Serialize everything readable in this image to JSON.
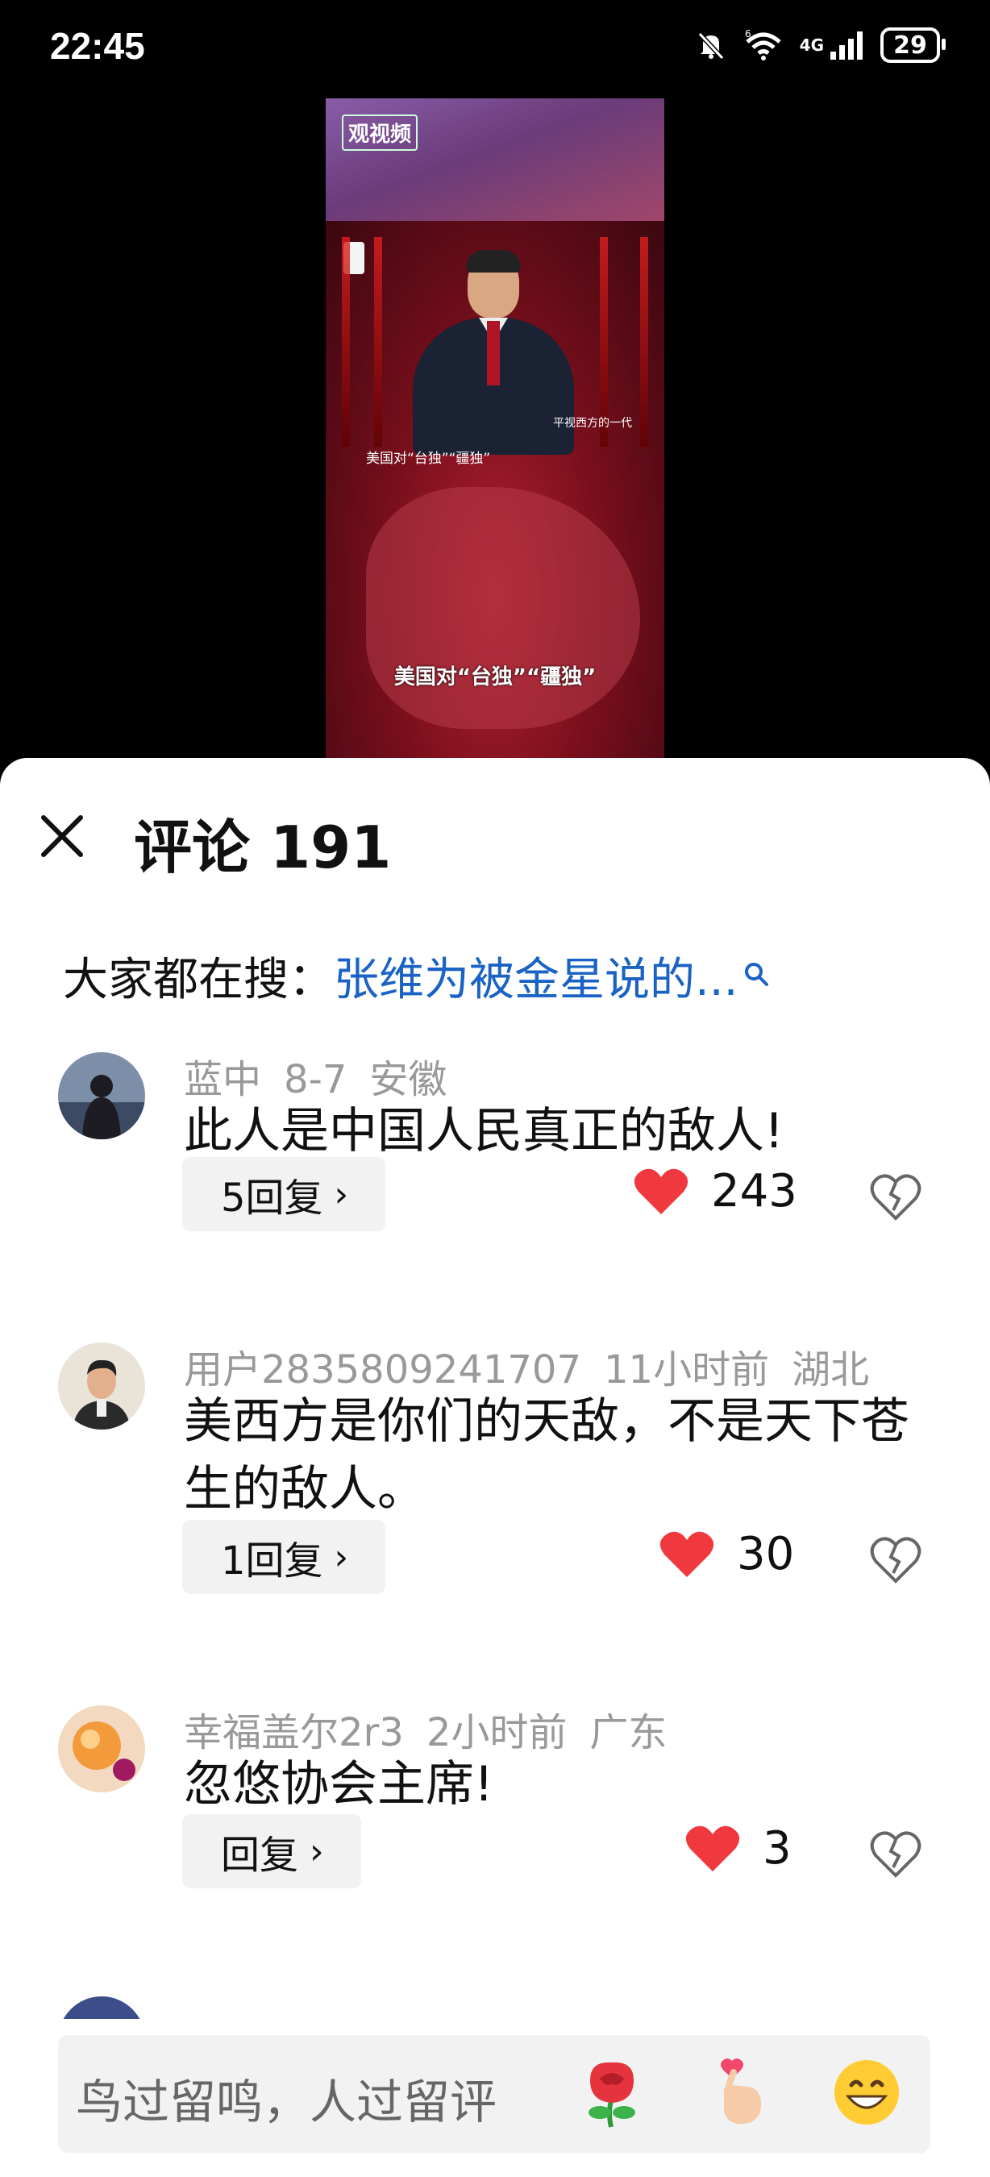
{
  "status_bar": {
    "time": "22:45",
    "signal_label": "4G",
    "wifi_label": "6",
    "battery": "29"
  },
  "video": {
    "logo": "观视频",
    "caption": "美国对“台独”“疆独”",
    "caption_small": "美国对“台独”“疆独”",
    "tag": "平视西方的一代"
  },
  "comments_panel": {
    "title": "评论 191",
    "search_prefix": "大家都在搜：",
    "search_link": "张维为被金星说的..."
  },
  "comments": [
    {
      "user": "蓝中",
      "date": "8-7",
      "location": "安徽",
      "text": "此人是中国人民真正的敌人!",
      "reply_label": "5回复",
      "likes": "243"
    },
    {
      "user": "用户2835809241707",
      "date": "11小时前",
      "location": "湖北",
      "text": "美西方是你们的天敌，不是天下苍生的敌人。",
      "reply_label": "1回复",
      "likes": "30"
    },
    {
      "user": "幸福盖尔2r3",
      "date": "2小时前",
      "location": "广东",
      "text": "忽悠协会主席!",
      "reply_label": "回复",
      "likes": "3"
    }
  ],
  "input": {
    "placeholder": "鸟过留鸣，人过留评"
  },
  "colors": {
    "like_red": "#f0383f",
    "link_blue": "#1a63c4"
  }
}
